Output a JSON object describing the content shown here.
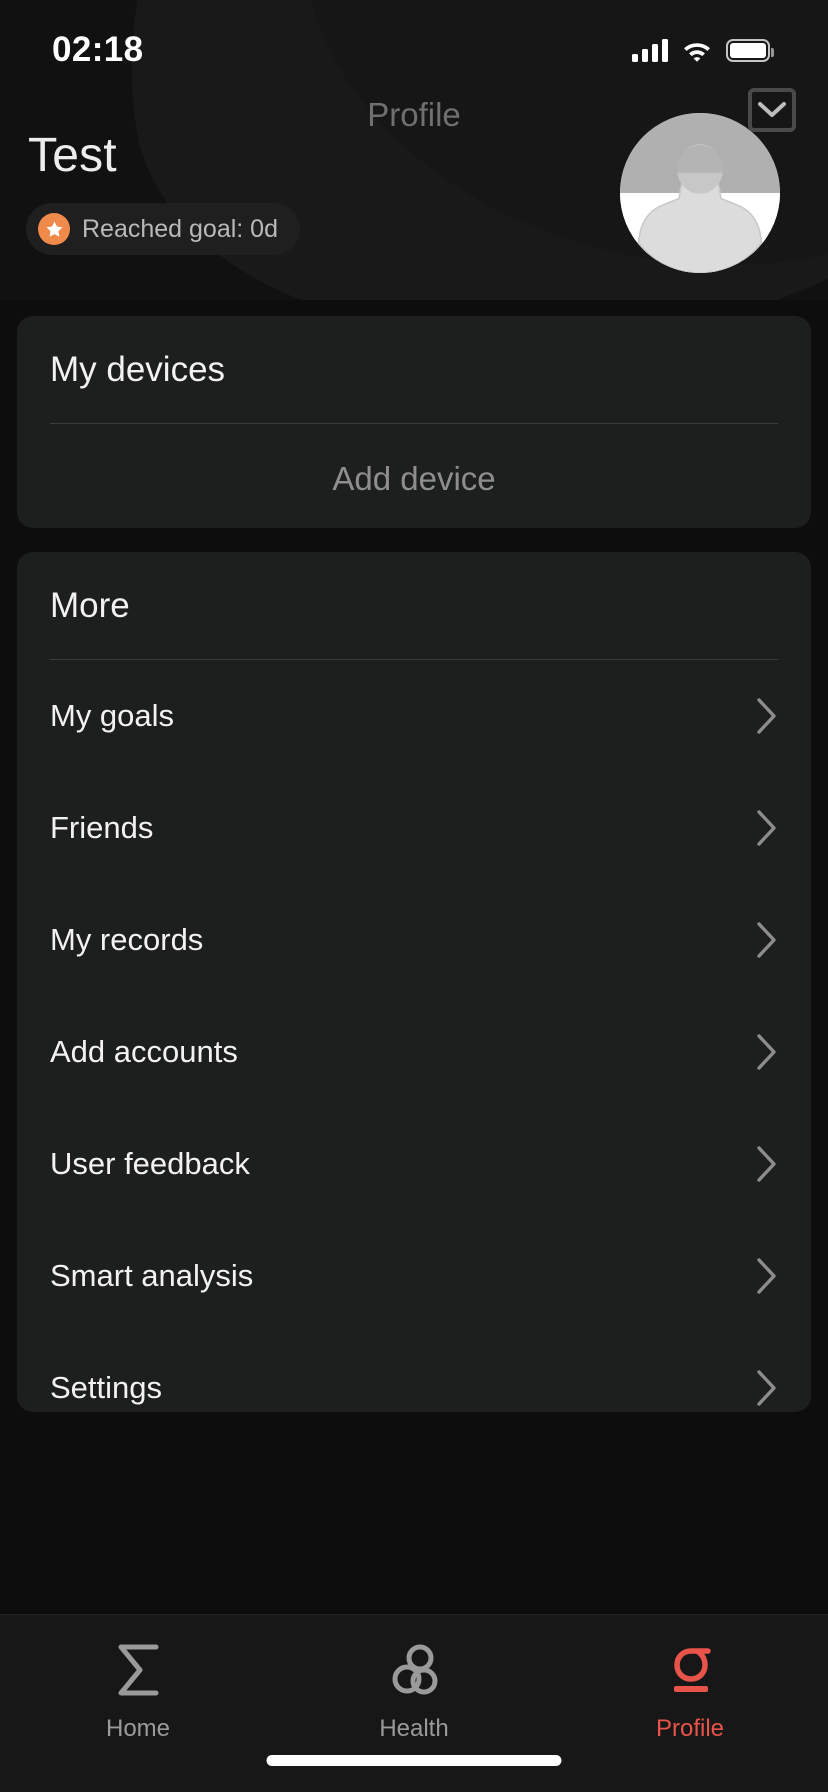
{
  "status_bar": {
    "time": "02:18",
    "signal_icon": "cellular-signal-icon",
    "wifi_icon": "wifi-icon",
    "battery_icon": "battery-icon"
  },
  "header": {
    "nav_title": "Profile",
    "user_name": "Test",
    "goal_badge": {
      "text": "Reached goal: 0d",
      "icon": "star-icon",
      "icon_color": "#ef8a4b"
    },
    "avatar_icon": "default-avatar-icon",
    "collapse_icon": "chevron-down-icon"
  },
  "devices_card": {
    "title": "My devices",
    "add_device_label": "Add device"
  },
  "more_card": {
    "title": "More",
    "items": [
      {
        "label": "My goals",
        "chevron": "chevron-right-icon"
      },
      {
        "label": "Friends",
        "chevron": "chevron-right-icon"
      },
      {
        "label": "My records",
        "chevron": "chevron-right-icon"
      },
      {
        "label": "Add accounts",
        "chevron": "chevron-right-icon"
      },
      {
        "label": "User feedback",
        "chevron": "chevron-right-icon"
      },
      {
        "label": "Smart analysis",
        "chevron": "chevron-right-icon"
      },
      {
        "label": "Settings",
        "chevron": "chevron-right-icon"
      }
    ]
  },
  "tab_bar": {
    "active_color": "#e8544a",
    "inactive_color": "#9a9a9a",
    "tabs": [
      {
        "label": "Home",
        "icon": "sigma-icon",
        "active": false
      },
      {
        "label": "Health",
        "icon": "knot-loops-icon",
        "active": false
      },
      {
        "label": "Profile",
        "icon": "sigma-lower-icon",
        "active": true
      }
    ]
  }
}
